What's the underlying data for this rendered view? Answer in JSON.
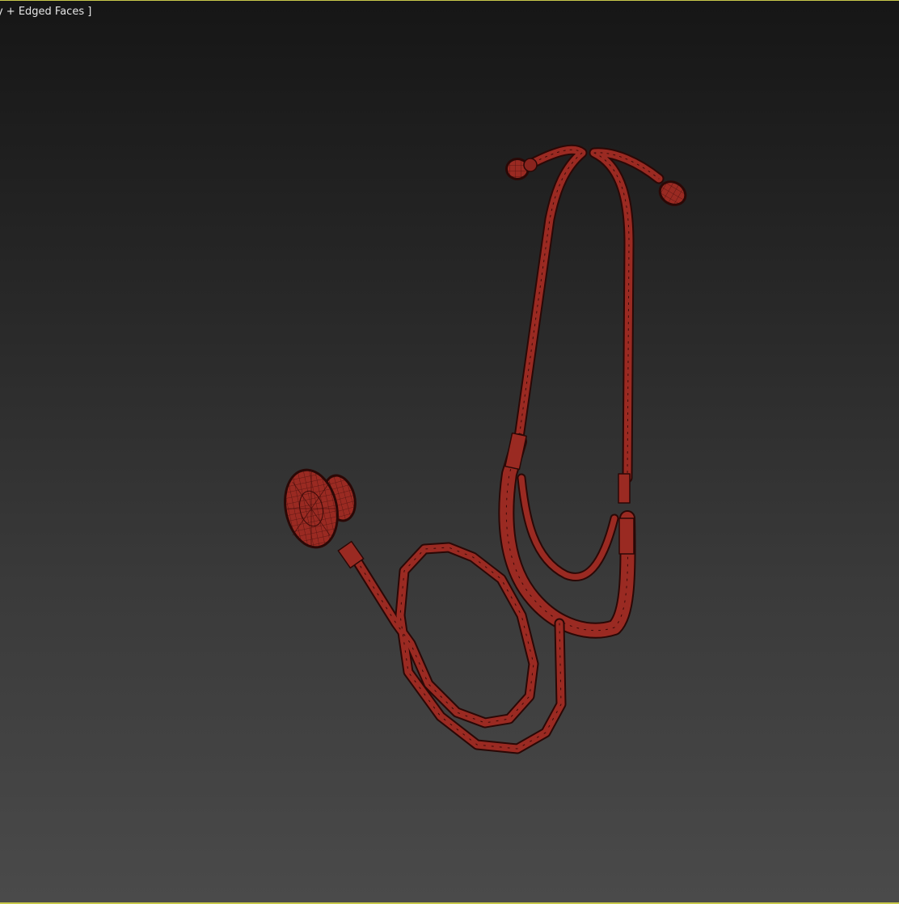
{
  "viewport": {
    "label": "ay  + Edged Faces ]",
    "object_color": "#9a2a22",
    "wire_color": "#3a0a08",
    "frame_color": "#c8c84a"
  },
  "scene": {
    "object": "stethoscope-model",
    "parts": [
      "ear-tip-left",
      "ear-tip-right",
      "headset-tube",
      "binaural-yoke",
      "main-tube",
      "chest-piece"
    ]
  }
}
